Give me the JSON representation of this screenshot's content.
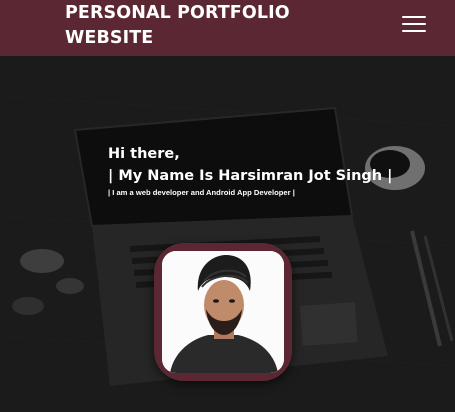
{
  "header": {
    "title_line1": "PERSONAL PORTFOLIO",
    "title_line2": "WEBSITE",
    "menu_icon": "hamburger-menu-icon",
    "background_color": "#5b2732"
  },
  "hero": {
    "greeting": "Hi there,",
    "name_line": "| My Name Is Harsimran Jot Singh |",
    "tagline": "| I am a web developer and Android App Developer |"
  },
  "colors": {
    "accent": "#5b2732",
    "text": "#ffffff"
  }
}
